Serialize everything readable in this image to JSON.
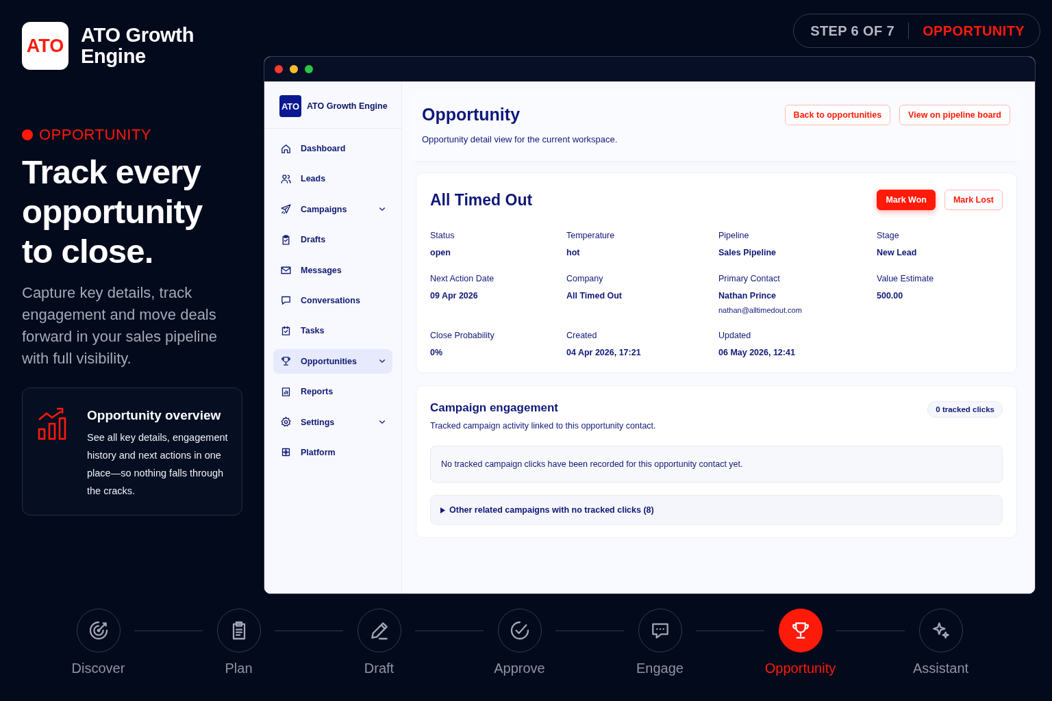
{
  "brand": {
    "logo": "ATO",
    "name": "ATO Growth Engine"
  },
  "step_indicator": {
    "step": "STEP 6 OF 7",
    "name": "OPPORTUNITY"
  },
  "hero": {
    "eyebrow": "OPPORTUNITY",
    "headline": "Track every opportunity to close.",
    "body": "Capture key details, track engagement and move deals forward in your sales pipeline with full visibility."
  },
  "feature_card": {
    "title": "Opportunity overview",
    "text": "See all key details, engagement history and next actions in one place—so nothing falls through the cracks."
  },
  "app": {
    "sidebar": {
      "logo": "ATO",
      "name": "ATO Growth Engine",
      "items": [
        {
          "label": "Dashboard",
          "selected": false,
          "has_submenu": false
        },
        {
          "label": "Leads",
          "selected": false,
          "has_submenu": false
        },
        {
          "label": "Campaigns",
          "selected": false,
          "has_submenu": true
        },
        {
          "label": "Drafts",
          "selected": false,
          "has_submenu": false
        },
        {
          "label": "Messages",
          "selected": false,
          "has_submenu": false
        },
        {
          "label": "Conversations",
          "selected": false,
          "has_submenu": false
        },
        {
          "label": "Tasks",
          "selected": false,
          "has_submenu": false
        },
        {
          "label": "Opportunities",
          "selected": true,
          "has_submenu": true
        },
        {
          "label": "Reports",
          "selected": false,
          "has_submenu": false
        },
        {
          "label": "Settings",
          "selected": false,
          "has_submenu": true
        },
        {
          "label": "Platform",
          "selected": false,
          "has_submenu": false
        }
      ]
    },
    "header": {
      "title": "Opportunity",
      "subtitle": "Opportunity detail view for the current workspace.",
      "buttons": [
        "Back to opportunities",
        "View on pipeline board"
      ]
    },
    "record": {
      "title": "All Timed Out",
      "actions": [
        {
          "label": "Mark Won",
          "kind": "primary"
        },
        {
          "label": "Mark Lost",
          "kind": "secondary"
        }
      ],
      "fields": [
        {
          "label": "Status",
          "value": "open"
        },
        {
          "label": "Temperature",
          "value": "hot"
        },
        {
          "label": "Pipeline",
          "value": "Sales Pipeline"
        },
        {
          "label": "Stage",
          "value": "New Lead"
        },
        {
          "label": "Next Action Date",
          "value": "09 Apr 2026"
        },
        {
          "label": "Company",
          "value": "All Timed Out"
        },
        {
          "label": "Primary Contact",
          "value": "Nathan Prince",
          "detail": "nathan@alltimedout.com"
        },
        {
          "label": "Value Estimate",
          "value": "500.00"
        },
        {
          "label": "Close Probability",
          "value": "0%"
        },
        {
          "label": "Created",
          "value": "04 Apr 2026, 17:21"
        },
        {
          "label": "Updated",
          "value": "06 May 2026, 12:41"
        }
      ]
    },
    "engagement": {
      "title": "Campaign engagement",
      "subtitle": "Tracked campaign activity linked to this opportunity contact.",
      "badge": "0 tracked clicks",
      "empty_message": "No tracked campaign clicks have been recorded for this opportunity contact yet.",
      "related": {
        "label": "Other related campaigns with no tracked clicks (8)",
        "expanded": false
      }
    }
  },
  "steps": [
    {
      "label": "Discover",
      "selected": false
    },
    {
      "label": "Plan",
      "selected": false
    },
    {
      "label": "Draft",
      "selected": false
    },
    {
      "label": "Approve",
      "selected": false
    },
    {
      "label": "Engage",
      "selected": false
    },
    {
      "label": "Opportunity",
      "selected": true
    },
    {
      "label": "Assistant",
      "selected": false
    }
  ]
}
